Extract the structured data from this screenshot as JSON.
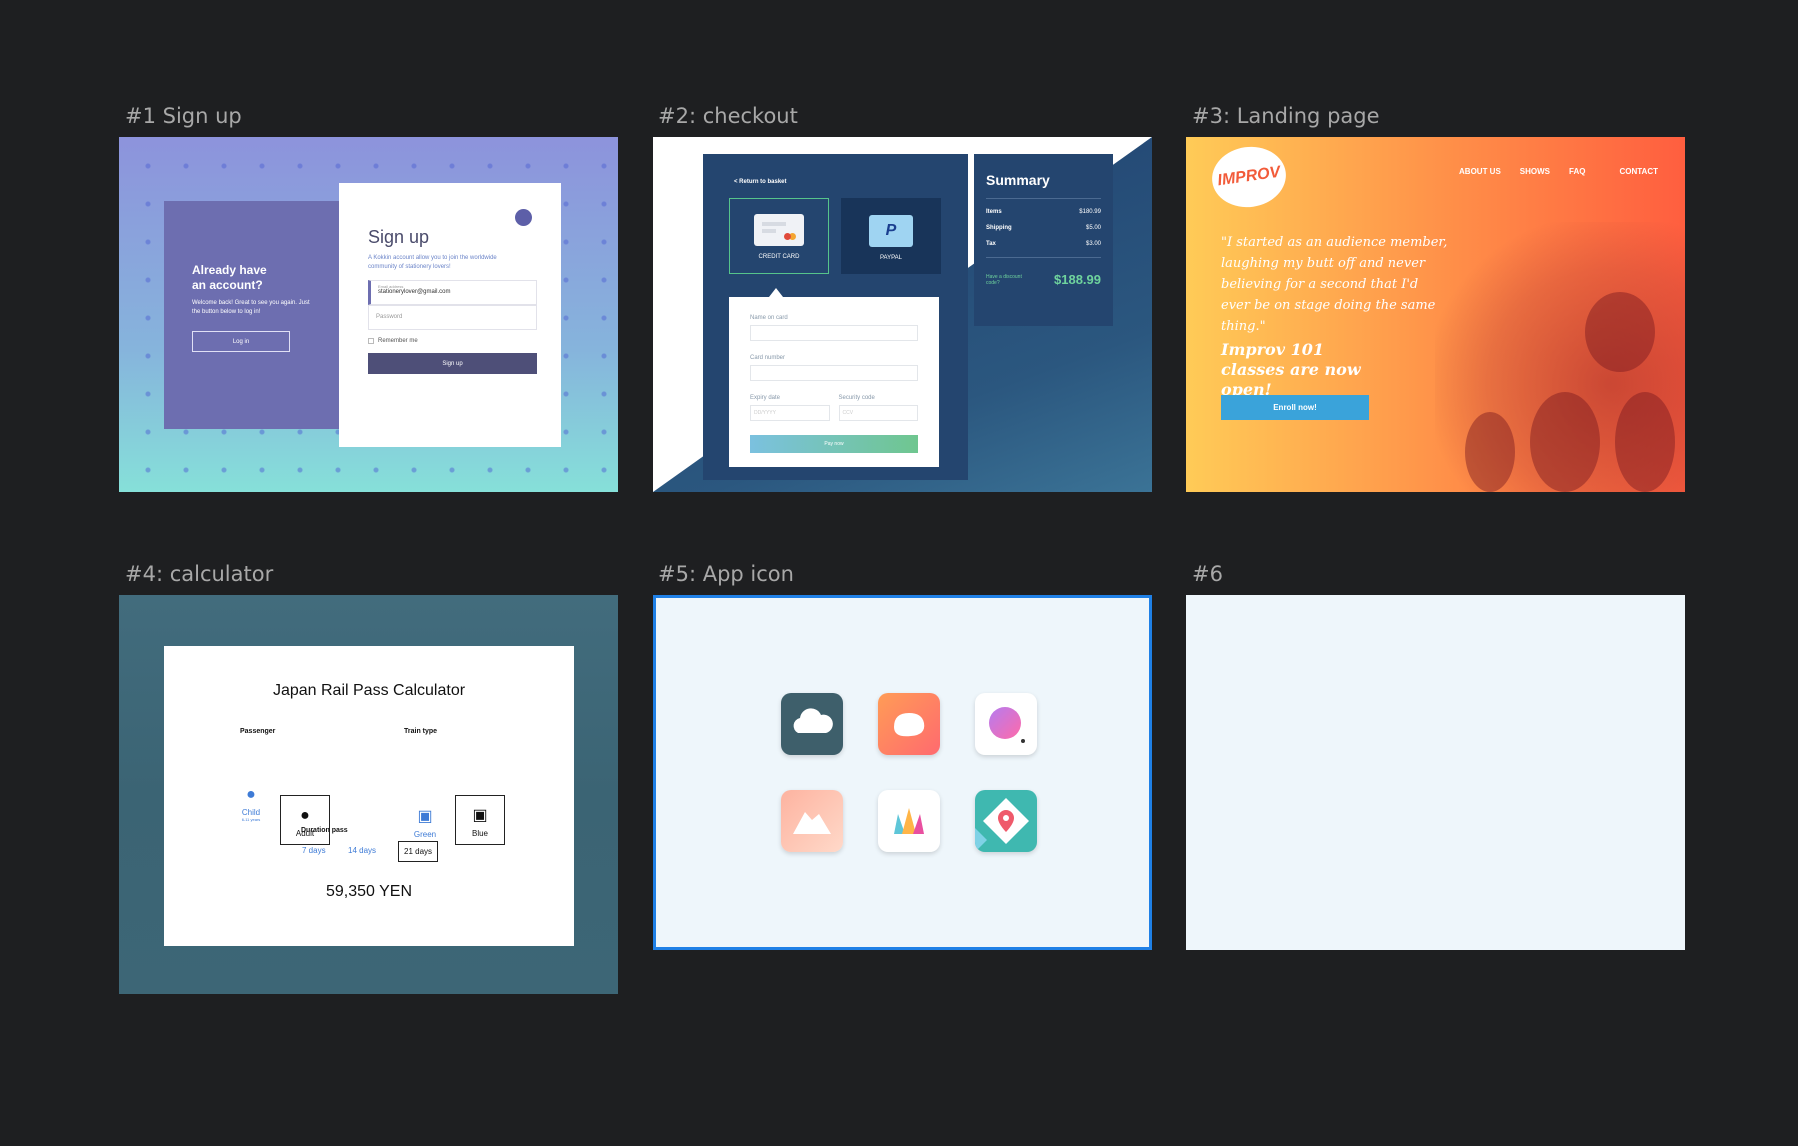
{
  "frames": {
    "f1": {
      "title": "#1 Sign up",
      "left_heading": "Already have an account?",
      "left_text": "Welcome back! Great to see you again. Just the button below to log in!",
      "login_label": "Log in",
      "heading": "Sign up",
      "subtitle": "A Kokkin account allow you to join the worldwide community of stationery lovers!",
      "email_label": "Email address",
      "email_value": "stationerylover@gmail.com",
      "password_placeholder": "Password",
      "remember_label": "Remember me",
      "signup_label": "Sign up",
      "accent_color": "#6d6eb0"
    },
    "f2": {
      "title": "#2: checkout",
      "back_label": "< Return to basket",
      "credit_card_label": "CREDIT CARD",
      "paypal_label": "PAYPAL",
      "name_label": "Name on card",
      "card_number_label": "Card number",
      "expiry_label": "Expiry date",
      "expiry_placeholder": "DD/YYYY",
      "security_label": "Security code",
      "security_placeholder": "CCV",
      "pay_label": "Pay now",
      "summary_title": "Summary",
      "summary_rows": [
        {
          "label": "Items",
          "value": "$180.99"
        },
        {
          "label": "Shipping",
          "value": "$5.00"
        },
        {
          "label": "Tax",
          "value": "$3.00"
        }
      ],
      "discount_label": "Have a discount code?",
      "total": "$188.99"
    },
    "f3": {
      "title": "#3: Landing page",
      "logo_text": "IMPROV",
      "nav": [
        "ABOUT US",
        "SHOWS",
        "FAQ",
        "CONTACT"
      ],
      "quote": "\"I started as an audience member, laughing my butt off and never believing for a second that I'd ever be on stage doing the same thing.\"",
      "headline": "Improv 101 classes are now open!",
      "cta_label": "Enroll now!"
    },
    "f4": {
      "title": "#4:  calculator",
      "heading": "Japan Rail Pass Calculator",
      "passenger_label": "Passenger",
      "train_label": "Train type",
      "child_label": "Child",
      "child_note": "6-11 years",
      "adult_label": "Adult",
      "green_label": "Green",
      "blue_label": "Blue",
      "duration_label": "Duration pass",
      "durations": [
        "7 days",
        "14 days",
        "21 days"
      ],
      "total": "59,350 YEN"
    },
    "f5": {
      "title": "#5: App icon",
      "icons": [
        "cloud-app-icon",
        "orange-blob-app-icon",
        "sphere-app-icon",
        "mountain-app-icon",
        "crown-app-icon",
        "map-pin-app-icon"
      ]
    },
    "f6": {
      "title": "#6"
    }
  }
}
